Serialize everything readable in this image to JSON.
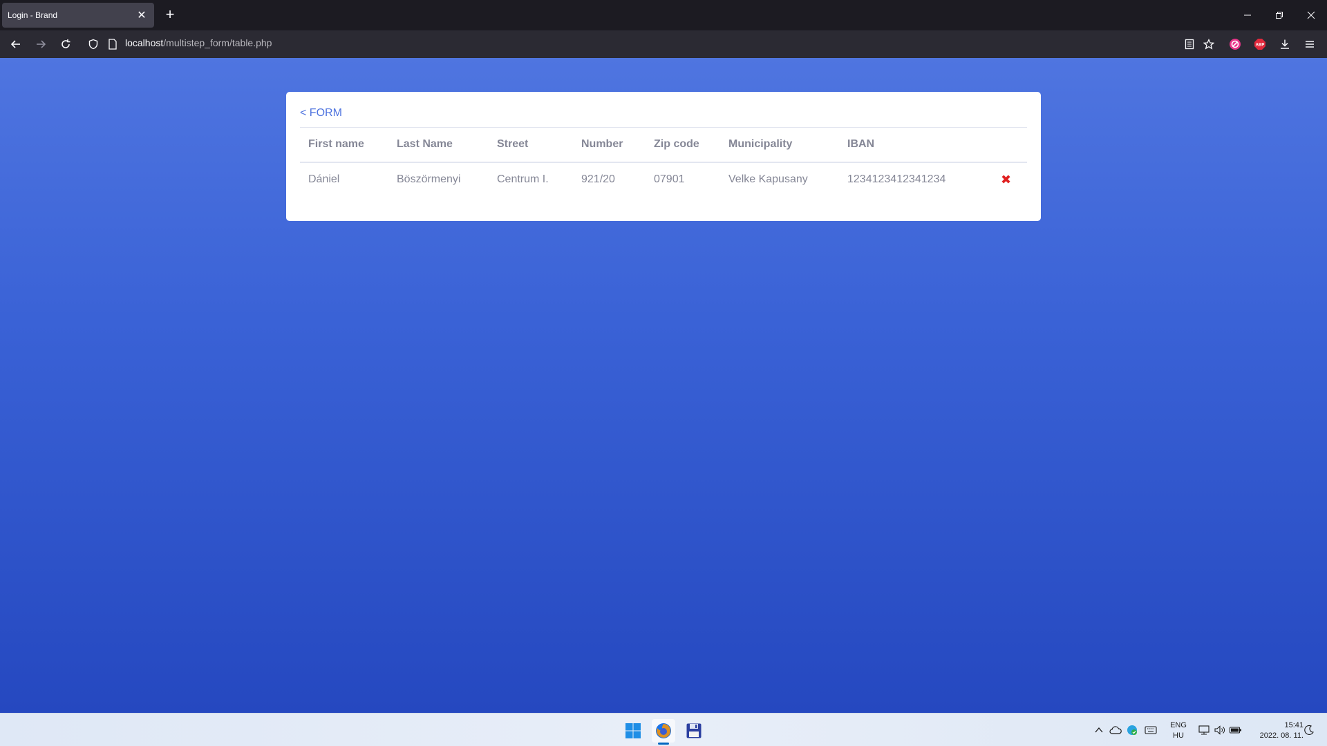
{
  "browser": {
    "tab_title": "Login - Brand",
    "url_host": "localhost",
    "url_path": "/multistep_form/table.php"
  },
  "card": {
    "back_link": "< FORM",
    "headers": [
      "First name",
      "Last Name",
      "Street",
      "Number",
      "Zip code",
      "Municipality",
      "IBAN"
    ],
    "rows": [
      {
        "first_name": "Dániel",
        "last_name": "Böszörmenyi",
        "street": "Centrum I.",
        "number": "921/20",
        "zip": "07901",
        "municipality": "Velke Kapusany",
        "iban": "1234123412341234",
        "delete": "✖"
      }
    ]
  },
  "taskbar": {
    "lang_top": "ENG",
    "lang_bottom": "HU",
    "time": "15:41",
    "date": "2022. 08. 11."
  },
  "colors": {
    "accent": "#4e73df",
    "delete": "#e02020"
  }
}
